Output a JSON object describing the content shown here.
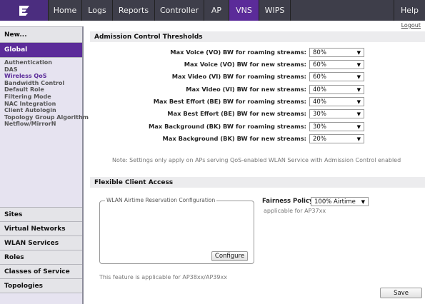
{
  "nav": {
    "items": [
      "Home",
      "Logs",
      "Reports",
      "Controller",
      "AP",
      "VNS",
      "WIPS"
    ],
    "active": "VNS",
    "help": "Help",
    "logout": "Logout"
  },
  "sidebar": {
    "new_label": "New...",
    "global_label": "Global",
    "links": [
      "Authentication",
      "DAS",
      "Wireless QoS",
      "Bandwidth Control",
      "Default Role",
      "Filtering Mode",
      "NAC Integration",
      "Client Autologin",
      "Topology Group Algorithm",
      "Netflow/MirrorN"
    ],
    "active_link": "Wireless QoS",
    "sections": [
      "Sites",
      "Virtual Networks",
      "WLAN Services",
      "Roles",
      "Classes of Service",
      "Topologies"
    ]
  },
  "admission": {
    "title": "Admission Control Thresholds",
    "rows": [
      {
        "label": "Max Voice (VO) BW for roaming streams:",
        "value": "80%"
      },
      {
        "label": "Max Voice (VO) BW for new streams:",
        "value": "60%"
      },
      {
        "label": "Max Video (VI) BW for roaming streams:",
        "value": "60%"
      },
      {
        "label": "Max Video (VI) BW for new streams:",
        "value": "40%"
      },
      {
        "label": "Max Best Effort (BE) BW for roaming streams:",
        "value": "40%"
      },
      {
        "label": "Max Best Effort (BE) BW for new streams:",
        "value": "30%"
      },
      {
        "label": "Max Background (BK) BW for roaming streams:",
        "value": "30%"
      },
      {
        "label": "Max Background (BK) BW for new streams:",
        "value": "20%"
      }
    ],
    "note": "Note: Settings only apply on APs serving QoS-enabled WLAN Service with Admission Control enabled"
  },
  "flexible": {
    "title": "Flexible Client Access",
    "fieldset_legend": "WLAN Airtime Reservation Configuration",
    "configure_label": "Configure",
    "fairness_label": "Fairness Policy:",
    "fairness_value": "100% Airtime",
    "fairness_note": "applicable for AP37xx",
    "feature_note": "This feature is applicable for AP38xx/AP39xx"
  },
  "save_label": "Save",
  "icons": {
    "logo": "extreme-logo-icon",
    "dropdown": "chevron-down-icon"
  },
  "colors": {
    "nav_bg": "#3e3e4a",
    "accent": "#5b2b99"
  }
}
